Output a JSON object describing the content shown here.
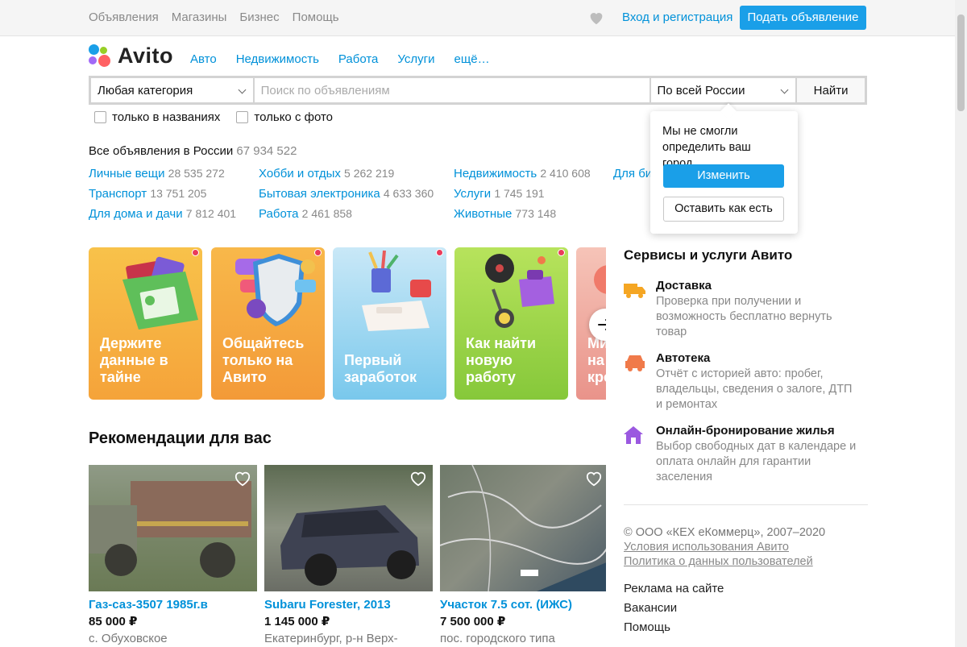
{
  "topbar": {
    "nav": [
      "Объявления",
      "Магазины",
      "Бизнес",
      "Помощь"
    ],
    "login": "Вход и регистрация",
    "post_button": "Подать объявление"
  },
  "logo": {
    "text": "Avito"
  },
  "main_nav": [
    "Авто",
    "Недвижимость",
    "Работа",
    "Услуги",
    "ещё…"
  ],
  "search": {
    "category": "Любая категория",
    "query_placeholder": "Поиск по объявлениям",
    "region": "По всей России",
    "find_button": "Найти",
    "only_titles": "только в названиях",
    "only_photo": "только с фото"
  },
  "all_ads": {
    "label": "Все объявления в России",
    "count": "67 934 522"
  },
  "categories": [
    {
      "name": "Личные вещи",
      "count": "28 535 272"
    },
    {
      "name": "Транспорт",
      "count": "13 751 205"
    },
    {
      "name": "Для дома и дачи",
      "count": "7 812 401"
    },
    {
      "name": "Хобби и отдых",
      "count": "5 262 219"
    },
    {
      "name": "Бытовая электроника",
      "count": "4 633 360"
    },
    {
      "name": "Работа",
      "count": "2 461 858"
    },
    {
      "name": "Недвижимость",
      "count": "2 410 608"
    },
    {
      "name": "Услуги",
      "count": "1 745 191"
    },
    {
      "name": "Животные",
      "count": "773 148"
    },
    {
      "name": "Для би",
      "count": ""
    }
  ],
  "city_popup": {
    "text": "Мы не смогли определить ваш город",
    "change": "Изменить",
    "keep": "Оставить как есть"
  },
  "promos": [
    {
      "title": "Держите данные в тайне",
      "color_top": "#f8c24a",
      "color_bottom": "#f5a33a"
    },
    {
      "title": "Общайтесь только на Авито",
      "color_top": "#f8b84a",
      "color_bottom": "#f39a38"
    },
    {
      "title": "Первый заработок",
      "color_top": "#c9e8f7",
      "color_bottom": "#79c8ec"
    },
    {
      "title": "Как найти новую работу",
      "color_top": "#b7e35c",
      "color_bottom": "#86c83a"
    },
    {
      "title": "Ми на кре",
      "color_top": "#f6c4b8",
      "color_bottom": "#e9938a"
    }
  ],
  "recommendations": {
    "title": "Рекомендации для вас",
    "items": [
      {
        "name": "Газ-саз-3507 1985г.в",
        "price": "85 000 ₽",
        "location": "с. Обуховское"
      },
      {
        "name": "Subaru Forester, 2013",
        "price": "1 145 000 ₽",
        "location": "Екатеринбург, р-н Верх-"
      },
      {
        "name": "Участок 7.5 сот. (ИЖС)",
        "price": "7 500 000 ₽",
        "location": "пос. городского типа"
      }
    ]
  },
  "services": {
    "title": "Сервисы и услуги Авито",
    "items": [
      {
        "name": "Доставка",
        "desc": "Проверка при получении и возможность бесплатно вернуть товар",
        "icon": "delivery-truck-icon",
        "color": "#f5a623"
      },
      {
        "name": "Автотека",
        "desc": "Отчёт с историей авто: пробег, владельцы, сведения о залоге, ДТП и ремонтах",
        "icon": "car-icon",
        "color": "#f07a4a"
      },
      {
        "name": "Онлайн-бронирование жилья",
        "desc": "Выбор свободных дат в календаре и оплата онлайн для гарантии заселения",
        "icon": "house-icon",
        "color": "#9b59e0"
      }
    ]
  },
  "footer": {
    "copyright": "© ООО «КЕХ еКоммерц», 2007–2020",
    "terms": "Условия использования Авито",
    "privacy": "Политика о данных пользователей",
    "links": [
      "Реклама на сайте",
      "Вакансии",
      "Помощь"
    ]
  }
}
